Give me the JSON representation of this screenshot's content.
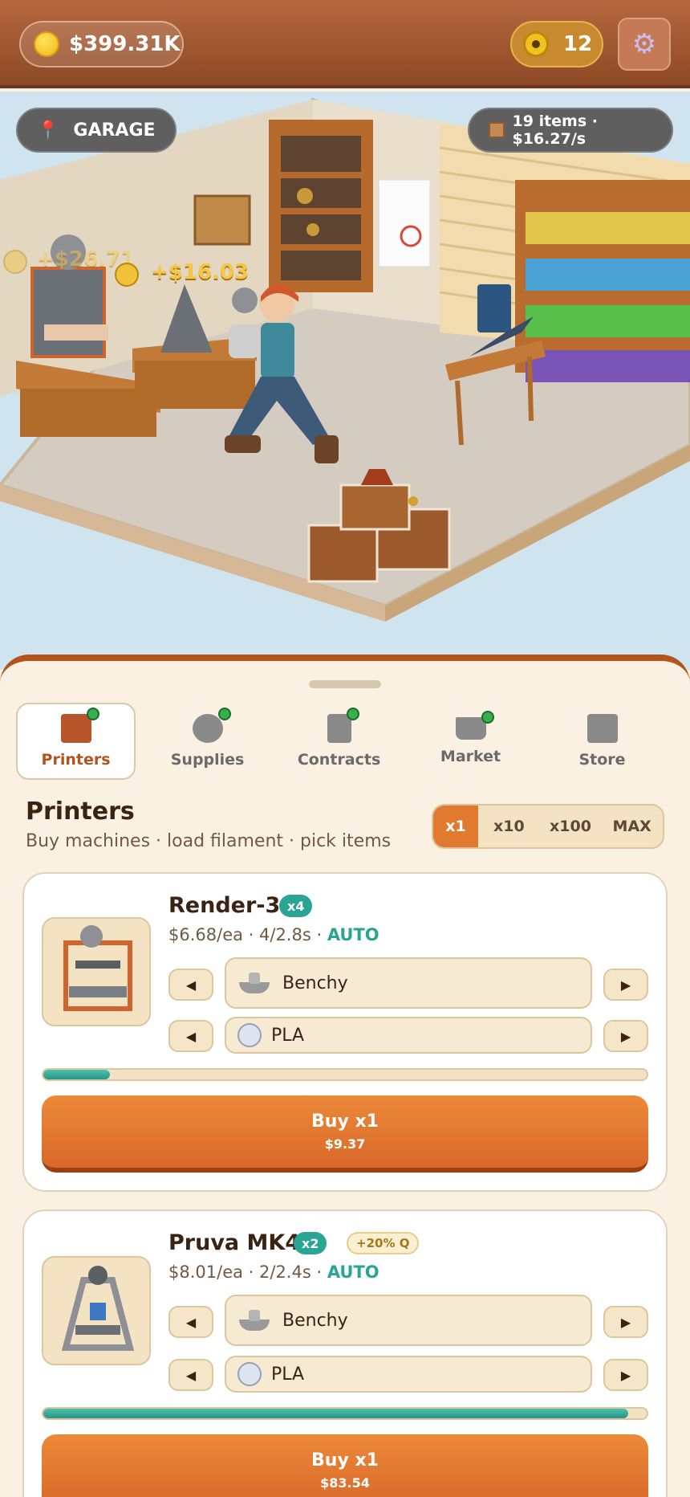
{
  "header": {
    "money": "$399.31K",
    "tokens": "12",
    "settings_icon": "gear-icon"
  },
  "scene": {
    "location": "GARAGE",
    "stats": "19 items · $16.27/s",
    "floating_earnings": [
      "+$26.71",
      "+$16.03"
    ]
  },
  "tabs": [
    {
      "label": "Printers",
      "icon": "printer-icon",
      "active": true,
      "dot": true
    },
    {
      "label": "Supplies",
      "icon": "filament-icon",
      "active": false,
      "dot": true
    },
    {
      "label": "Contracts",
      "icon": "document-icon",
      "active": false,
      "dot": true
    },
    {
      "label": "Market",
      "icon": "cart-icon",
      "active": false,
      "dot": true
    },
    {
      "label": "Store",
      "icon": "store-icon",
      "active": false,
      "dot": false
    }
  ],
  "section": {
    "title": "Printers",
    "subtitle": "Buy machines · load filament · pick items",
    "multipliers": [
      "x1",
      "x10",
      "x100",
      "MAX"
    ],
    "active_multiplier": "x1"
  },
  "printers": [
    {
      "name": "Render-3",
      "count_badge": "x4",
      "boost": "",
      "rate": "$6.68/ea · 4/2.8s · ",
      "mode": "AUTO",
      "item": "Benchy",
      "material": "PLA",
      "progress": 0.11,
      "buy_label": "Buy x1",
      "buy_price": "$9.37"
    },
    {
      "name": "Pruva MK4",
      "count_badge": "x2",
      "boost": "+20% Q",
      "rate": "$8.01/ea · 2/2.4s · ",
      "mode": "AUTO",
      "item": "Benchy",
      "material": "PLA",
      "progress": 0.97,
      "buy_label": "Buy x1",
      "buy_price": "$83.54"
    }
  ],
  "colors": {
    "accent": "#e17a2f",
    "teal": "#2aa494",
    "topbar": "#a2582f"
  }
}
